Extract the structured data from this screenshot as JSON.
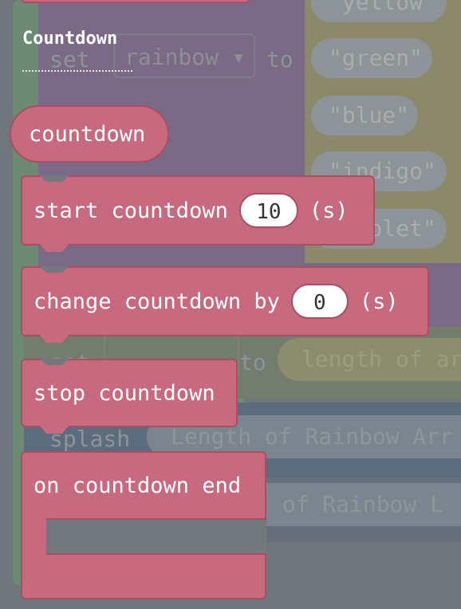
{
  "flyout": {
    "category": "Countdown",
    "blocks": {
      "countdown_reporter": "countdown",
      "start_countdown": {
        "label": "start countdown",
        "value": "10",
        "unit": "(s)"
      },
      "change_countdown": {
        "label": "change countdown by",
        "value": "0",
        "unit": "(s)"
      },
      "stop_countdown": "stop countdown",
      "on_countdown_end": "on countdown end"
    },
    "colors": {
      "block_fill": "#c76a7f",
      "block_border": "#a84f63",
      "input_fill": "#ffffff"
    }
  },
  "background_workspace": {
    "pills": [
      "\"yellow\"",
      "\"green\"",
      "\"blue\"",
      "\"indigo\"",
      "\"violet\""
    ],
    "set_rainbow": {
      "set": "set",
      "variable": "rainbow",
      "to": "to"
    },
    "set_length_row": {
      "set": "set",
      "to": "to",
      "value": "length of ar"
    },
    "splash_row": {
      "label": "splash",
      "value": "Length of Rainbow Arr"
    },
    "end_row": {
      "value": "d of Rainbow L"
    }
  }
}
